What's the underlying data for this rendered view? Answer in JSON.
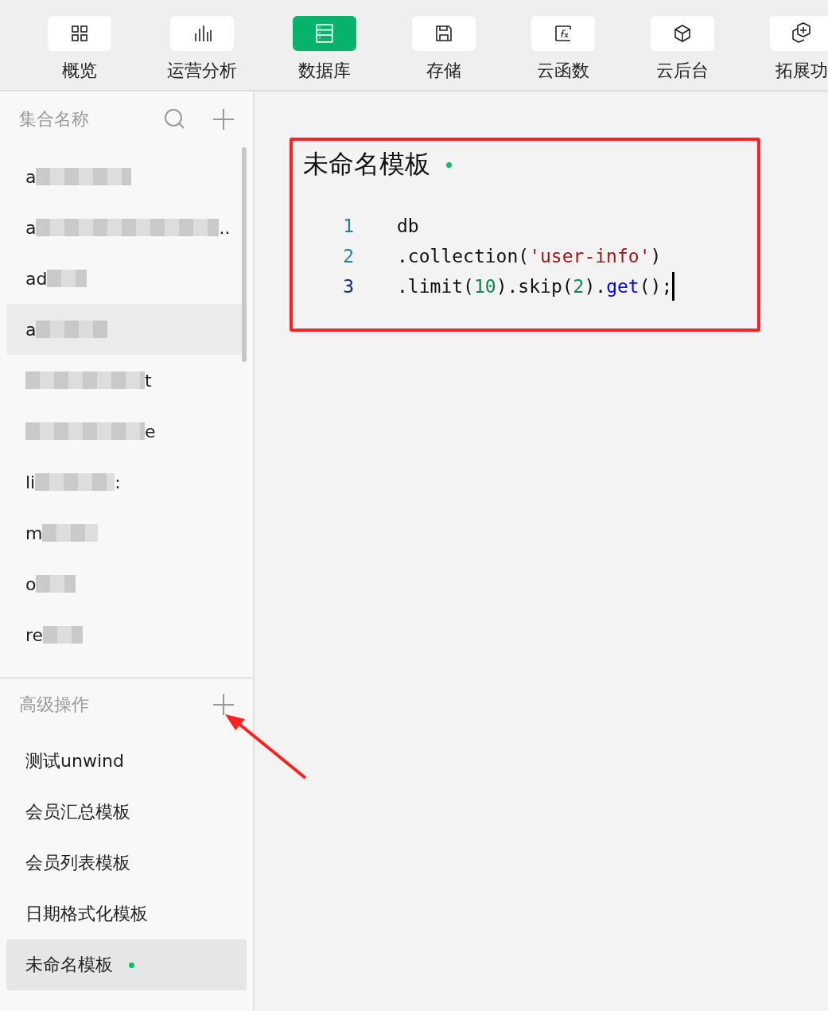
{
  "toolbar": {
    "tabs": [
      {
        "label": "概览",
        "selected": false
      },
      {
        "label": "运营分析",
        "selected": false
      },
      {
        "label": "数据库",
        "selected": true
      },
      {
        "label": "存储",
        "selected": false
      },
      {
        "label": "云函数",
        "selected": false
      },
      {
        "label": "云后台",
        "selected": false
      },
      {
        "label": "拓展功",
        "selected": false
      }
    ]
  },
  "collections": {
    "title": "集合名称",
    "items": [
      {
        "prefix": "a",
        "selected": false
      },
      {
        "prefix": "a",
        "suffix": "..",
        "selected": false
      },
      {
        "prefix": "ad",
        "selected": false
      },
      {
        "prefix": "a",
        "selected": true
      },
      {
        "suffix": "t",
        "selected": false
      },
      {
        "suffix": "e",
        "selected": false
      },
      {
        "prefix": "li",
        "suffix": ":",
        "selected": false
      },
      {
        "prefix": "m",
        "selected": false
      },
      {
        "prefix": "o",
        "selected": false
      },
      {
        "prefix": "re",
        "selected": false
      }
    ]
  },
  "advanced": {
    "title": "高级操作",
    "items": [
      {
        "label": "测试unwind",
        "unsaved": false,
        "selected": false
      },
      {
        "label": "会员汇总模板",
        "unsaved": false,
        "selected": false
      },
      {
        "label": "会员列表模板",
        "unsaved": false,
        "selected": false
      },
      {
        "label": "日期格式化模板",
        "unsaved": false,
        "selected": false
      },
      {
        "label": "未命名模板",
        "unsaved": true,
        "selected": true
      }
    ]
  },
  "editor": {
    "title": "未命名模板",
    "unsaved": true,
    "lines": [
      {
        "number": "1",
        "active": false,
        "tokens": [
          {
            "kind": "plain",
            "text": "db"
          }
        ]
      },
      {
        "number": "2",
        "active": false,
        "tokens": [
          {
            "kind": "plain",
            "text": ".collection("
          },
          {
            "kind": "string",
            "text": "'user-info'"
          },
          {
            "kind": "plain",
            "text": ")"
          }
        ]
      },
      {
        "number": "3",
        "active": true,
        "tokens": [
          {
            "kind": "plain",
            "text": ".limit("
          },
          {
            "kind": "number",
            "text": "10"
          },
          {
            "kind": "plain",
            "text": ").skip("
          },
          {
            "kind": "number",
            "text": "2"
          },
          {
            "kind": "plain",
            "text": ")."
          },
          {
            "kind": "method",
            "text": "get"
          },
          {
            "kind": "plain",
            "text": "();"
          }
        ]
      }
    ]
  }
}
